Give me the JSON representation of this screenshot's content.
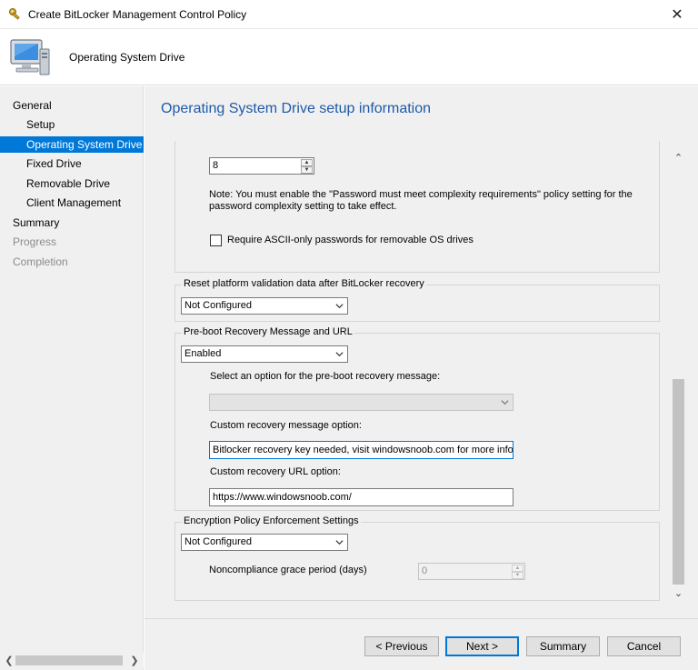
{
  "window": {
    "title": "Create BitLocker Management Control Policy",
    "close_glyph": "✕"
  },
  "header": {
    "title": "Operating System Drive",
    "icon": "computer-icon"
  },
  "sidebar": {
    "items": [
      {
        "label": "General",
        "state": "normal"
      },
      {
        "label": "Setup",
        "state": "normal"
      },
      {
        "label": "Operating System Drive",
        "state": "selected"
      },
      {
        "label": "Fixed Drive",
        "state": "normal"
      },
      {
        "label": "Removable Drive",
        "state": "normal"
      },
      {
        "label": "Client Management",
        "state": "normal"
      },
      {
        "label": "Summary",
        "state": "normal"
      },
      {
        "label": "Progress",
        "state": "disabled"
      },
      {
        "label": "Completion",
        "state": "disabled"
      }
    ]
  },
  "main": {
    "page_title": "Operating System Drive setup information",
    "password_section": {
      "length_value": "8",
      "note": "Note: You must enable the \"Password must meet complexity requirements\" policy setting for the password complexity setting to take effect.",
      "ascii_checkbox_label": "Require ASCII-only passwords for removable OS drives",
      "ascii_checked": false
    },
    "reset_platform": {
      "legend": "Reset platform validation data after BitLocker recovery",
      "value": "Not Configured"
    },
    "preboot": {
      "legend": "Pre-boot Recovery Message and URL",
      "value": "Enabled",
      "option_label": "Select an option for the pre-boot recovery message:",
      "option_value": "",
      "custom_message_label": "Custom recovery message option:",
      "custom_message_value": "Bitlocker recovery key needed, visit windowsnoob.com for more info",
      "custom_url_label": "Custom recovery URL option:",
      "custom_url_value": "https://www.windowsnoob.com/"
    },
    "encryption": {
      "legend": "Encryption Policy Enforcement Settings",
      "value": "Not Configured",
      "grace_label": "Noncompliance grace period (days)",
      "grace_value": "0"
    }
  },
  "buttons": {
    "previous": "< Previous",
    "next": "Next >",
    "summary": "Summary",
    "cancel": "Cancel"
  },
  "colors": {
    "accent": "#0078d7",
    "title_blue": "#1e5aa8"
  }
}
